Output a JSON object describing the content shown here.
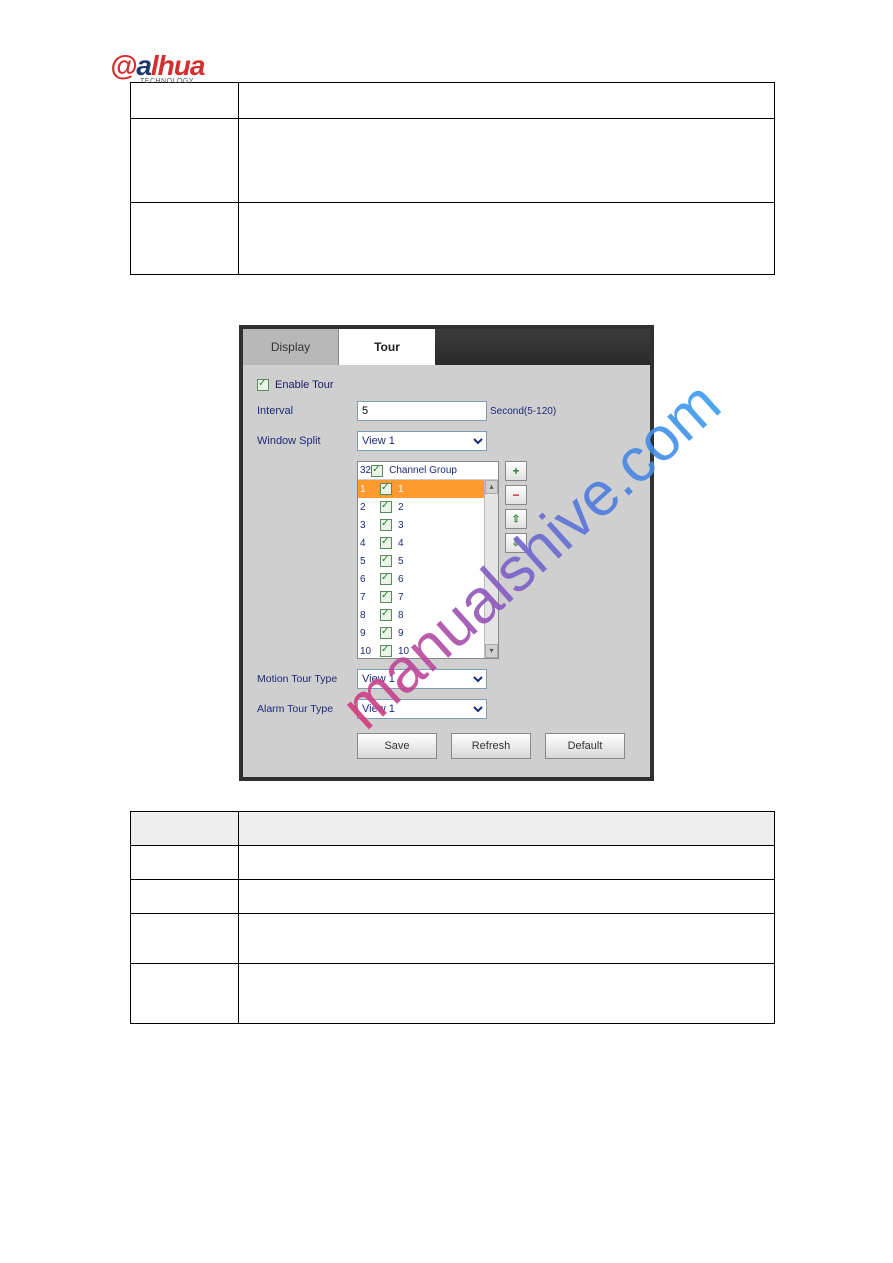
{
  "logo": {
    "brand_prefix": "@",
    "brand_a": "a",
    "brand_rest": "lhua",
    "sub": "TECHNOLOGY"
  },
  "watermark": "manualshive.com",
  "table1": {
    "rows": [
      {
        "param": "",
        "desc": ""
      },
      {
        "param": "",
        "desc": ""
      },
      {
        "param": "",
        "desc": ""
      }
    ]
  },
  "figure": {
    "tabs": {
      "display": "Display",
      "tour": "Tour"
    },
    "enable_tour_label": "Enable Tour",
    "interval_label": "Interval",
    "interval_value": "5",
    "interval_unit": "Second(5-120)",
    "window_split_label": "Window Split",
    "window_split_value": "View 1",
    "list_header_count": "32",
    "list_header_label": "Channel Group",
    "items": [
      {
        "n": "1",
        "g": "1",
        "sel": true
      },
      {
        "n": "2",
        "g": "2"
      },
      {
        "n": "3",
        "g": "3"
      },
      {
        "n": "4",
        "g": "4"
      },
      {
        "n": "5",
        "g": "5"
      },
      {
        "n": "6",
        "g": "6"
      },
      {
        "n": "7",
        "g": "7"
      },
      {
        "n": "8",
        "g": "8"
      },
      {
        "n": "9",
        "g": "9"
      },
      {
        "n": "10",
        "g": "10"
      }
    ],
    "motion_label": "Motion Tour Type",
    "motion_value": "View 1",
    "alarm_label": "Alarm Tour Type",
    "alarm_value": "View 1",
    "buttons": {
      "save": "Save",
      "refresh": "Refresh",
      "default": "Default"
    },
    "caption": ""
  },
  "table2": {
    "header": {
      "param": "",
      "desc": ""
    },
    "rows": [
      {
        "param": "",
        "desc": ""
      },
      {
        "param": "",
        "desc": ""
      },
      {
        "param": "",
        "desc": ""
      },
      {
        "param": "",
        "desc": ""
      }
    ]
  }
}
